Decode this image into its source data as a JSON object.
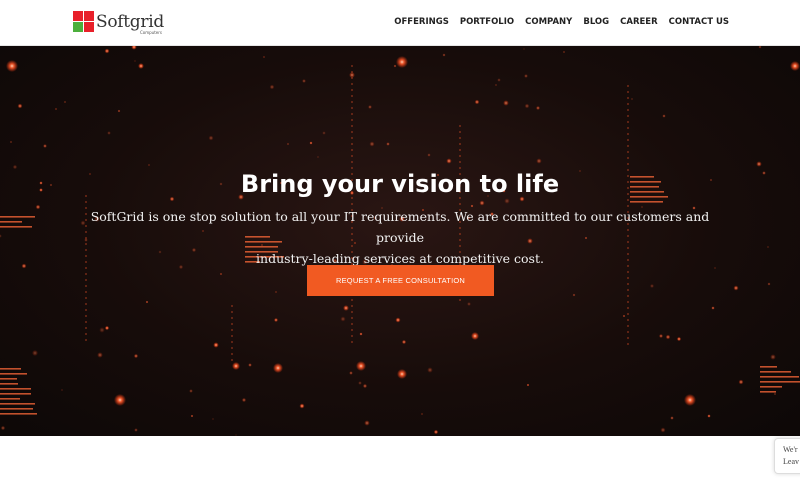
{
  "brand": {
    "name": "Softgrid",
    "tagline": "Computers",
    "colors": {
      "red": "#e8202a",
      "green": "#4caf3c"
    }
  },
  "nav": {
    "items": [
      {
        "label": "OFFERINGS"
      },
      {
        "label": "PORTFOLIO"
      },
      {
        "label": "COMPANY"
      },
      {
        "label": "BLOG"
      },
      {
        "label": "CAREER"
      },
      {
        "label": "CONTACT US"
      }
    ]
  },
  "hero": {
    "title": "Bring your vision to life",
    "text_line1": "SoftGrid is one stop solution to all your IT requirements. We are committed to our customers and provide",
    "text_line2": "industry-leading services at competitive cost.",
    "cta_label": "REQUEST A FREE CONSULTATION",
    "accent_color": "#f15a22"
  },
  "chat_widget": {
    "line1": "We'r",
    "line2": "Leav"
  }
}
